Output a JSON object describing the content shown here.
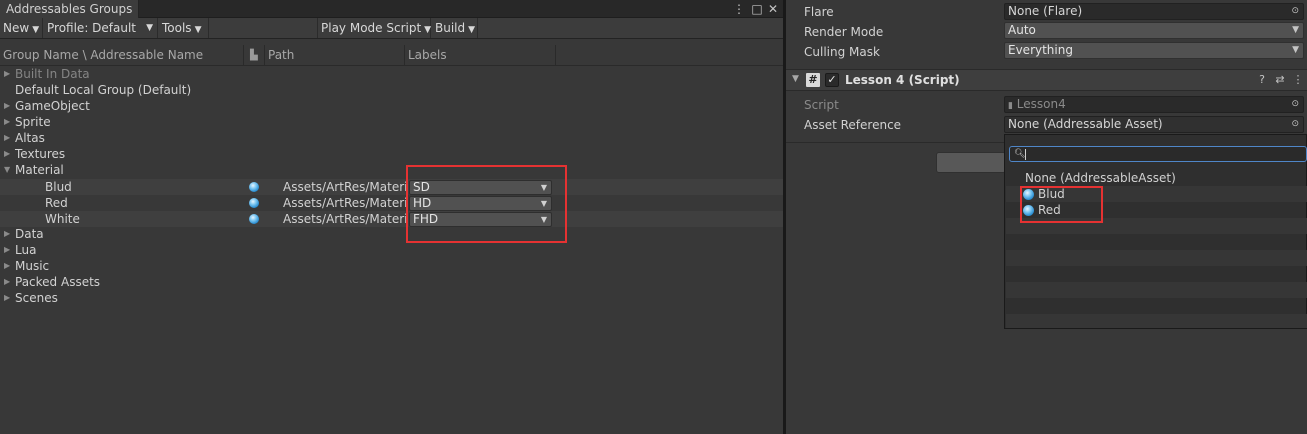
{
  "left_panel": {
    "tab_title": "Addressables Groups",
    "window_icons": [
      "⋮",
      "□",
      "✕"
    ],
    "toolbar": {
      "new_label": "New",
      "profile_label": "Profile: Default",
      "tools_label": "Tools",
      "play_mode_label": "Play Mode Script",
      "build_label": "Build"
    },
    "columns": {
      "name": "Group Name \\ Addressable Name",
      "path": "Path",
      "labels": "Labels"
    },
    "groups": [
      {
        "label": "Built In Data",
        "expanded": false,
        "dim": true
      },
      {
        "label": "Default Local Group (Default)",
        "expanded": false,
        "no_arrow": true
      },
      {
        "label": "GameObject",
        "expanded": false
      },
      {
        "label": "Sprite",
        "expanded": false
      },
      {
        "label": "Altas",
        "expanded": false
      },
      {
        "label": "Textures",
        "expanded": false
      },
      {
        "label": "Material",
        "expanded": true
      }
    ],
    "entries": [
      {
        "name": "Blud",
        "path": "Assets/ArtRes/Materi",
        "label": "SD"
      },
      {
        "name": "Red",
        "path": "Assets/ArtRes/Materi",
        "label": "HD"
      },
      {
        "name": "White",
        "path": "Assets/ArtRes/Materi",
        "label": "FHD"
      }
    ],
    "groups_after": [
      {
        "label": "Data"
      },
      {
        "label": "Lua"
      },
      {
        "label": "Music"
      },
      {
        "label": "Packed Assets"
      },
      {
        "label": "Scenes"
      }
    ]
  },
  "right_panel": {
    "props_top": [
      {
        "label": "Flare",
        "value": "None (Flare)",
        "kind": "object"
      },
      {
        "label": "Render Mode",
        "value": "Auto",
        "kind": "dropdown"
      },
      {
        "label": "Culling Mask",
        "value": "Everything",
        "kind": "dropdown"
      }
    ],
    "component": {
      "title": "Lesson 4 (Script)",
      "enabled": true,
      "icons": [
        "?",
        "⇄",
        "⋮"
      ]
    },
    "script_label": "Script",
    "script_value": "Lesson4",
    "asset_ref_label": "Asset Reference",
    "asset_ref_value": "None (Addressable Asset)",
    "popup": {
      "search_value": "",
      "none_option": "None (AddressableAsset)",
      "options": [
        "Blud",
        "Red"
      ]
    }
  },
  "colors": {
    "highlight_box": "#e53232",
    "search_focus": "#4f86c8",
    "addressable_icon": "#2b8fd3"
  }
}
